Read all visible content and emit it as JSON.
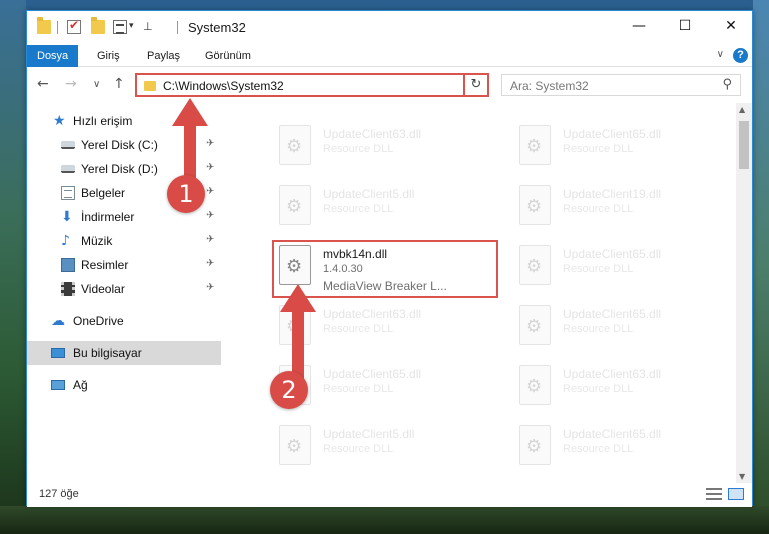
{
  "window": {
    "title": "System32",
    "minimize_glyph": "—",
    "maximize_glyph": "☐",
    "close_glyph": "✕"
  },
  "ribbon": {
    "tabs": [
      {
        "label": "Dosya",
        "active": true
      },
      {
        "label": "Giriş",
        "active": false
      },
      {
        "label": "Paylaş",
        "active": false
      },
      {
        "label": "Görünüm",
        "active": false
      }
    ],
    "help_glyph": "?",
    "expand_glyph": "∨"
  },
  "navbar": {
    "back_glyph": "←",
    "forward_glyph": "→",
    "recent_glyph": "∨",
    "up_glyph": "↑",
    "address": "C:\\Windows\\System32",
    "address_dropdown": "∨",
    "refresh_glyph": "↻",
    "search_placeholder": "Ara: System32",
    "search_glyph": "⚲"
  },
  "sidebar": {
    "items": [
      {
        "label": "Hızlı erişim",
        "icon": "star-icon",
        "pinned": false
      },
      {
        "label": "Yerel Disk (C:)",
        "icon": "drive-icon",
        "pinned": true
      },
      {
        "label": "Yerel Disk (D:)",
        "icon": "drive-icon",
        "pinned": true
      },
      {
        "label": "Belgeler",
        "icon": "documents-icon",
        "pinned": true
      },
      {
        "label": "İndirmeler",
        "icon": "downloads-icon",
        "pinned": true
      },
      {
        "label": "Müzik",
        "icon": "music-icon",
        "pinned": true
      },
      {
        "label": "Resimler",
        "icon": "pictures-icon",
        "pinned": true
      },
      {
        "label": "Videolar",
        "icon": "videos-icon",
        "pinned": true
      },
      {
        "label": "OneDrive",
        "icon": "cloud-icon",
        "pinned": false
      },
      {
        "label": "Bu bilgisayar",
        "icon": "computer-icon",
        "pinned": false,
        "selected": true
      },
      {
        "label": "Ağ",
        "icon": "network-icon",
        "pinned": false
      }
    ],
    "pin_glyph": "✈"
  },
  "files": {
    "left": [
      {
        "name": "UpdateClient63.dll",
        "type": "Resource DLL"
      },
      {
        "name": "UpdateClient5.dll",
        "type": "Resource DLL"
      },
      {
        "name": "mvbk14n.dll",
        "version": "1.4.0.30",
        "description": "MediaView Breaker L...",
        "highlighted": true
      },
      {
        "name": "UpdateClient63.dll",
        "type": "Resource DLL"
      },
      {
        "name": "UpdateClient65.dll",
        "type": "Resource DLL"
      },
      {
        "name": "UpdateClient5.dll",
        "type": "Resource DLL"
      }
    ],
    "right": [
      {
        "name": "UpdateClient65.dll",
        "type": "Resource DLL"
      },
      {
        "name": "UpdateClient19.dll",
        "type": "Resource DLL"
      },
      {
        "name": "UpdateClient65.dll",
        "type": "Resource DLL"
      },
      {
        "name": "UpdateClient65.dll",
        "type": "Resource DLL"
      },
      {
        "name": "UpdateClient63.dll",
        "type": "Resource DLL"
      },
      {
        "name": "UpdateClient65.dll",
        "type": "Resource DLL"
      }
    ]
  },
  "status": {
    "count": "127 öğe"
  },
  "annotations": [
    {
      "label": "1",
      "color": "#d84b46"
    },
    {
      "label": "2",
      "color": "#d84b46"
    }
  ],
  "colors": {
    "accent": "#1979ca",
    "highlight_border": "#d9534f"
  }
}
